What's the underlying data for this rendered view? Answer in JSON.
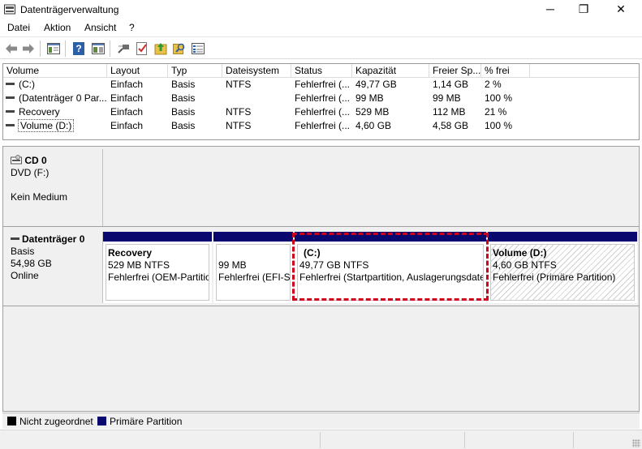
{
  "window": {
    "title": "Datenträgerverwaltung",
    "minimize_icon": "─",
    "maximize_icon": "❐",
    "close_icon": "✕"
  },
  "menu": [
    {
      "label": "Datei"
    },
    {
      "label": "Aktion"
    },
    {
      "label": "Ansicht"
    },
    {
      "label": "?"
    }
  ],
  "toolbar": [
    "back-icon",
    "forward-icon",
    "console-tree-icon",
    "help-icon",
    "properties-icon",
    "connect-icon",
    "check-icon",
    "up-arrow-icon",
    "search-icon",
    "list-icon"
  ],
  "volume_list": {
    "columns": [
      "Volume",
      "Layout",
      "Typ",
      "Dateisystem",
      "Status",
      "Kapazität",
      "Freier Sp...",
      "% frei"
    ],
    "rows": [
      [
        "(C:)",
        "Einfach",
        "Basis",
        "NTFS",
        "Fehlerfrei (...",
        "49,77 GB",
        "1,14 GB",
        "2 %"
      ],
      [
        "(Datenträger 0 Par...",
        "Einfach",
        "Basis",
        "",
        "Fehlerfrei (...",
        "99 MB",
        "99 MB",
        "100 %"
      ],
      [
        "Recovery",
        "Einfach",
        "Basis",
        "NTFS",
        "Fehlerfrei (...",
        "529 MB",
        "112 MB",
        "21 %"
      ],
      [
        "Volume (D:)",
        "Einfach",
        "Basis",
        "NTFS",
        "Fehlerfrei (...",
        "4,60 GB",
        "4,58 GB",
        "100 %"
      ]
    ]
  },
  "disks": {
    "cd": {
      "name": "CD 0",
      "type": "DVD (F:)",
      "status": "Kein Medium"
    },
    "disk0": {
      "name": "Datenträger 0",
      "type": "Basis",
      "size": "54,98 GB",
      "status": "Online",
      "partitions": [
        {
          "name": "Recovery",
          "size": "529 MB NTFS",
          "status": "Fehlerfrei (OEM-Partition)"
        },
        {
          "name": "",
          "size": "99 MB",
          "status": "Fehlerfrei (EFI-Systempartition)"
        },
        {
          "name": "(C:)",
          "size": "49,77 GB NTFS",
          "status": "Fehlerfrei (Startpartition, Auslagerungsdatei)"
        },
        {
          "name": "Volume  (D:)",
          "size": "4,60 GB NTFS",
          "status": "Fehlerfrei (Primäre Partition)"
        }
      ]
    }
  },
  "legend": [
    {
      "label": "Nicht zugeordnet",
      "color": "#000000"
    },
    {
      "label": "Primäre Partition",
      "color": "#08086e"
    }
  ],
  "colors": {
    "partition_bar": "#08086e",
    "selection": "#d0021b"
  }
}
